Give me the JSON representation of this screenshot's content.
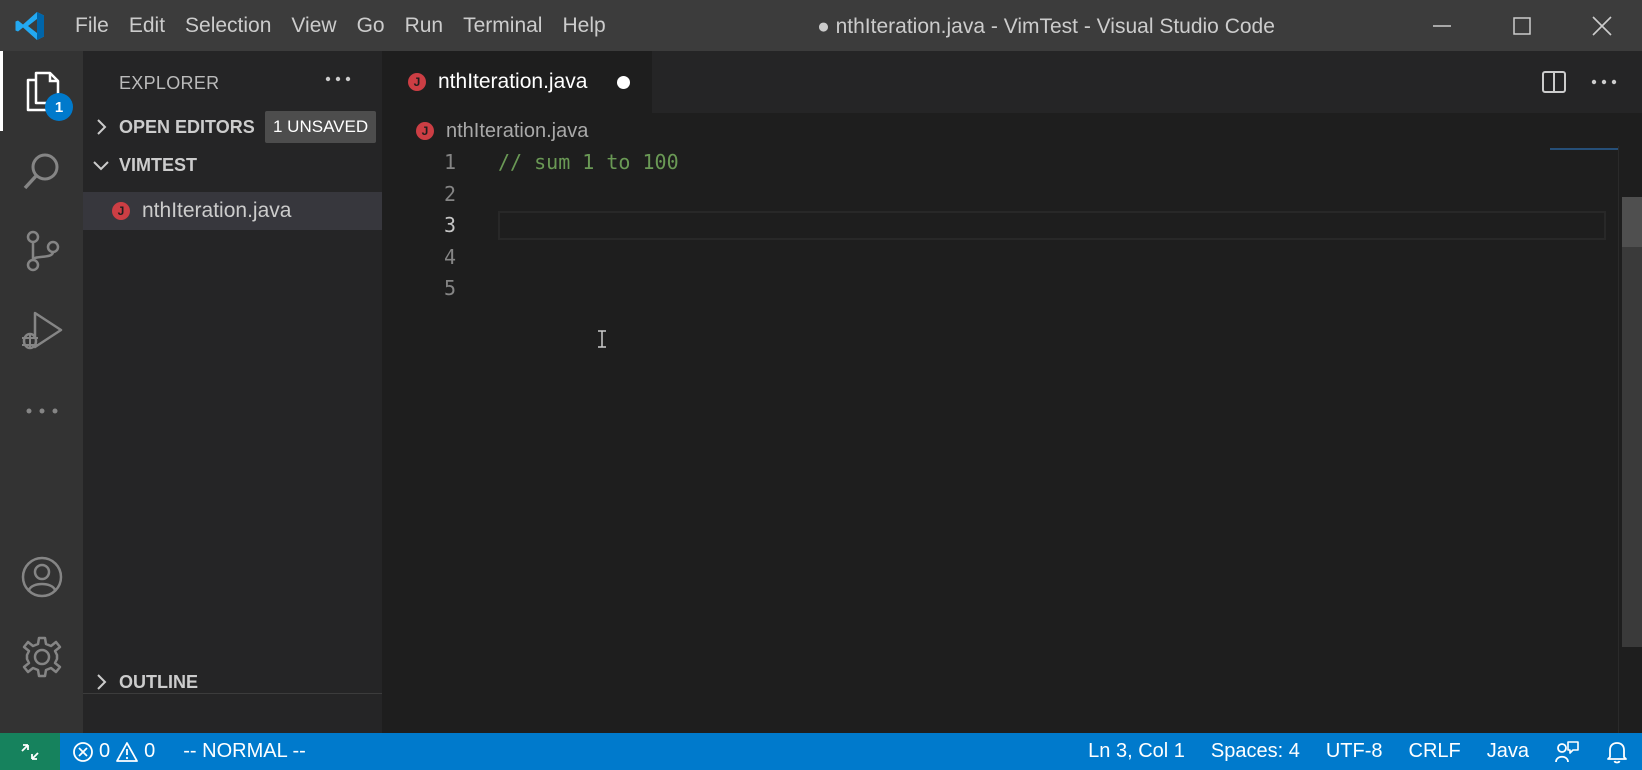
{
  "titlebar": {
    "menu": [
      "File",
      "Edit",
      "Selection",
      "View",
      "Go",
      "Run",
      "Terminal",
      "Help"
    ],
    "window_title": "● nthIteration.java - VimTest - Visual Studio Code"
  },
  "activitybar": {
    "explorer_badge": "1",
    "items": [
      "explorer-icon",
      "search-icon",
      "source-control-icon",
      "run-debug-icon",
      "more-icon",
      "account-icon",
      "settings-gear-icon"
    ]
  },
  "sidebar": {
    "title": "EXPLORER",
    "open_editors_label": "OPEN EDITORS",
    "unsaved_badge": "1 UNSAVED",
    "folder_label": "VIMTEST",
    "files": [
      {
        "name": "nthIteration.java",
        "icon_letter": "J"
      }
    ],
    "outline_label": "OUTLINE"
  },
  "editor": {
    "tab_label": "nthIteration.java",
    "tab_icon_letter": "J",
    "breadcrumb": "nthIteration.java",
    "lines": [
      {
        "number": "1",
        "text": "// sum 1 to 100"
      },
      {
        "number": "2",
        "text": ""
      },
      {
        "number": "3",
        "text": ""
      },
      {
        "number": "4",
        "text": ""
      },
      {
        "number": "5",
        "text": ""
      }
    ],
    "current_line": 3
  },
  "statusbar": {
    "errors": "0",
    "warnings": "0",
    "vim_mode": "-- NORMAL --",
    "position": "Ln 3, Col 1",
    "spaces": "Spaces: 4",
    "encoding": "UTF-8",
    "eol": "CRLF",
    "language": "Java"
  },
  "colors": {
    "accent": "#007acc",
    "remote": "#16825d",
    "java_icon": "#cc3e44",
    "comment": "#6a9955"
  }
}
